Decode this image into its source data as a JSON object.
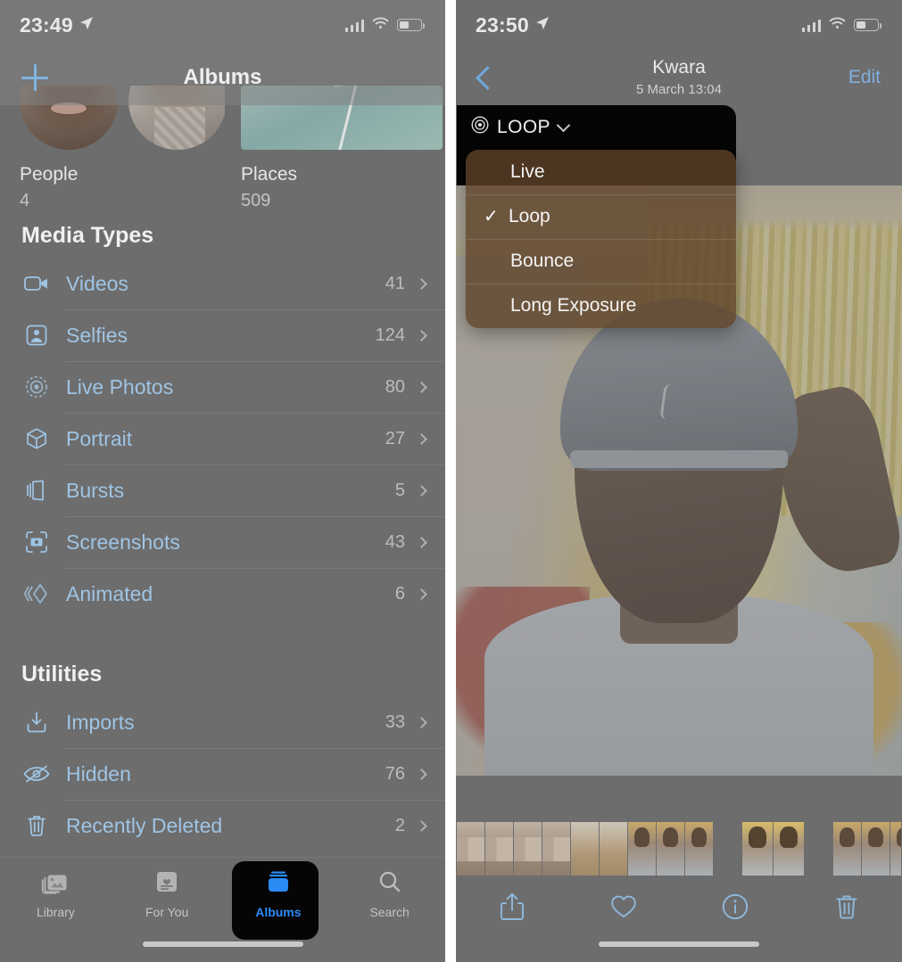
{
  "left_panel": {
    "status_bar": {
      "time": "23:49",
      "location_icon": "location-arrow-icon",
      "signal_icon": "cellular-signal-icon",
      "wifi_icon": "wifi-icon",
      "battery_icon": "battery-icon"
    },
    "nav": {
      "add_label": "+",
      "title": "Albums"
    },
    "cards": [
      {
        "label": "People",
        "count": "4",
        "type": "people"
      },
      {
        "label": "Places",
        "count": "509",
        "type": "places"
      }
    ],
    "sections": [
      {
        "heading": "Media Types",
        "rows": [
          {
            "icon": "video-camera-icon",
            "label": "Videos",
            "count": "41"
          },
          {
            "icon": "selfie-person-icon",
            "label": "Selfies",
            "count": "124"
          },
          {
            "icon": "live-photo-icon",
            "label": "Live Photos",
            "count": "80"
          },
          {
            "icon": "cube-portrait-icon",
            "label": "Portrait",
            "count": "27"
          },
          {
            "icon": "bursts-stack-icon",
            "label": "Bursts",
            "count": "5"
          },
          {
            "icon": "screenshot-icon",
            "label": "Screenshots",
            "count": "43"
          },
          {
            "icon": "animated-icon",
            "label": "Animated",
            "count": "6"
          }
        ]
      },
      {
        "heading": "Utilities",
        "rows": [
          {
            "icon": "import-tray-icon",
            "label": "Imports",
            "count": "33"
          },
          {
            "icon": "eye-slash-icon",
            "label": "Hidden",
            "count": "76"
          },
          {
            "icon": "trash-icon",
            "label": "Recently Deleted",
            "count": "2"
          }
        ]
      }
    ],
    "tabbar": {
      "tabs": [
        {
          "label": "Library",
          "icon": "photos-library-icon",
          "active": false
        },
        {
          "label": "For You",
          "icon": "for-you-icon",
          "active": false
        },
        {
          "label": "Albums",
          "icon": "albums-icon",
          "active": true
        },
        {
          "label": "Search",
          "icon": "search-icon",
          "active": false
        }
      ]
    }
  },
  "right_panel": {
    "status_bar": {
      "time": "23:50",
      "location_icon": "location-arrow-icon",
      "signal_icon": "cellular-signal-icon",
      "wifi_icon": "wifi-icon",
      "battery_icon": "battery-icon"
    },
    "nav": {
      "back_icon": "back-chevron-icon",
      "title": "Kwara",
      "subtitle": "5 March  13:04",
      "edit_label": "Edit"
    },
    "live_badge": {
      "icon": "live-photo-icon",
      "label": "LOOP",
      "caret_icon": "chevron-down-icon"
    },
    "effects_menu": {
      "items": [
        {
          "label": "Live",
          "checked": false
        },
        {
          "label": "Loop",
          "checked": true
        },
        {
          "label": "Bounce",
          "checked": false
        },
        {
          "label": "Long Exposure",
          "checked": false
        }
      ],
      "check_glyph": "✓"
    },
    "toolbar": {
      "buttons": [
        {
          "icon": "share-icon",
          "name": "share-button"
        },
        {
          "icon": "heart-icon",
          "name": "favorite-button"
        },
        {
          "icon": "info-icon",
          "name": "info-button"
        },
        {
          "icon": "trash-icon",
          "name": "delete-button"
        }
      ]
    }
  },
  "colors": {
    "accent_blue": "#2b8bf5",
    "tint_blue": "#9fc4e4",
    "panel_bg": "#6d6d6d",
    "menu_bg": "rgba(94,66,40,.80)",
    "badge_bg": "#050505"
  }
}
